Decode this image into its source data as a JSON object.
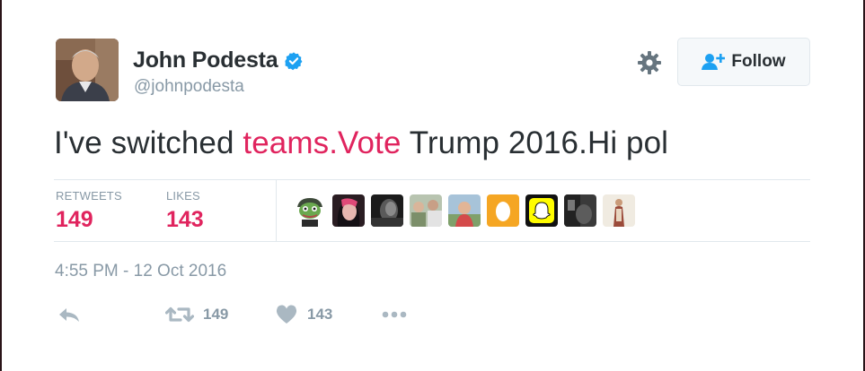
{
  "author": {
    "name": "John Podesta",
    "handle": "@johnpodesta",
    "verified": true
  },
  "header": {
    "follow_label": "Follow"
  },
  "tweet": {
    "text_before": "I've switched ",
    "text_link": "teams.Vote",
    "text_after": " Trump 2016.Hi pol",
    "timestamp": "4:55 PM - 12 Oct 2016"
  },
  "stats": {
    "retweets_label": "RETWEETS",
    "retweets_value": "149",
    "likes_label": "LIKES",
    "likes_value": "143"
  },
  "actions": {
    "retweet_count": "149",
    "like_count": "143"
  },
  "colors": {
    "link": "#e0245e",
    "secondary_text": "#8899a6",
    "verified": "#1da1f2",
    "follow_icon": "#1da1f2"
  }
}
